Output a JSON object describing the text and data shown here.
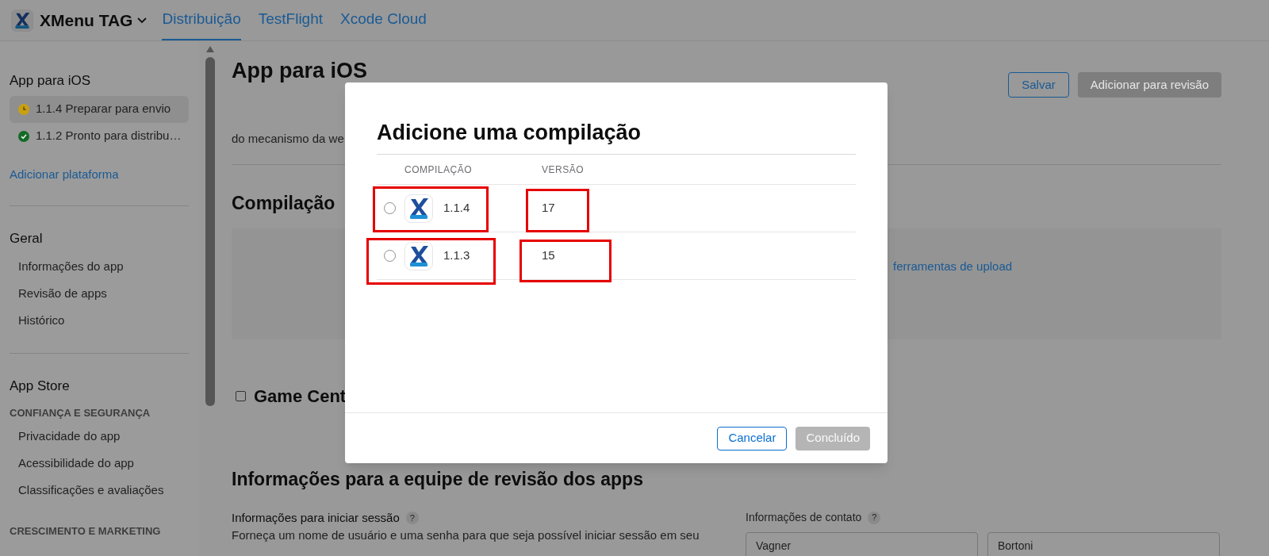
{
  "app": {
    "name": "XMenu TAG"
  },
  "tabs": [
    {
      "label": "Distribuição",
      "selected": true
    },
    {
      "label": "TestFlight",
      "selected": false
    },
    {
      "label": "Xcode Cloud",
      "selected": false
    }
  ],
  "sidebar": {
    "platform": {
      "title": "App para iOS",
      "versions": [
        {
          "label": "1.1.4 Preparar para envio",
          "kind": "clock",
          "selected": true
        },
        {
          "label": "1.1.2 Pronto para distribu…",
          "kind": "check",
          "selected": false
        }
      ],
      "add_link": "Adicionar plataforma"
    },
    "general": {
      "title": "Geral",
      "items": [
        {
          "label": "Informações do app",
          "selected": false
        },
        {
          "label": "Revisão de apps",
          "selected": false
        },
        {
          "label": "Histórico",
          "selected": false
        }
      ]
    },
    "app_store": {
      "title": "App Store",
      "groups": [
        {
          "title": "CONFIANÇA E SEGURANÇA",
          "items": [
            {
              "label": "Privacidade do app",
              "selected": false
            },
            {
              "label": "Acessibilidade do app",
              "selected": false
            },
            {
              "label": "Classificações e avaliações",
              "selected": false
            }
          ]
        },
        {
          "title": "CRESCIMENTO E MARKETING"
        }
      ]
    }
  },
  "page": {
    "title": "App para iOS",
    "buttons": [
      {
        "label": "Salvar",
        "disabled": false
      },
      {
        "label": "Adicionar para revisão",
        "disabled": true
      }
    ],
    "description": "do mecanismo da we",
    "build_section": {
      "title": "Compilação",
      "link": "ferramentas de upload"
    },
    "game_center": {
      "label": "Game Cent",
      "checked": false
    },
    "review_info": {
      "title": "Informações para a equipe de revisão dos apps",
      "sign_in": {
        "label": "Informações para iniciar sessão",
        "help": "?",
        "text": "Forneça um nome de usuário e uma senha para que seja possível iniciar sessão em seu"
      },
      "contact": {
        "label": "Informações de contato",
        "help": "?",
        "fields": [
          "Vagner",
          "Bortoni"
        ]
      }
    }
  },
  "dialog": {
    "title": "Adicione uma compilação",
    "columns": [
      "COMPILAÇÃO",
      "VERSÃO"
    ],
    "rows": [
      {
        "build": "1.1.4",
        "version": "17",
        "selected": false
      },
      {
        "build": "1.1.3",
        "version": "15",
        "selected": false
      }
    ],
    "buttons": [
      {
        "label": "Cancelar",
        "disabled": false
      },
      {
        "label": "Concluído",
        "disabled": true
      }
    ]
  }
}
